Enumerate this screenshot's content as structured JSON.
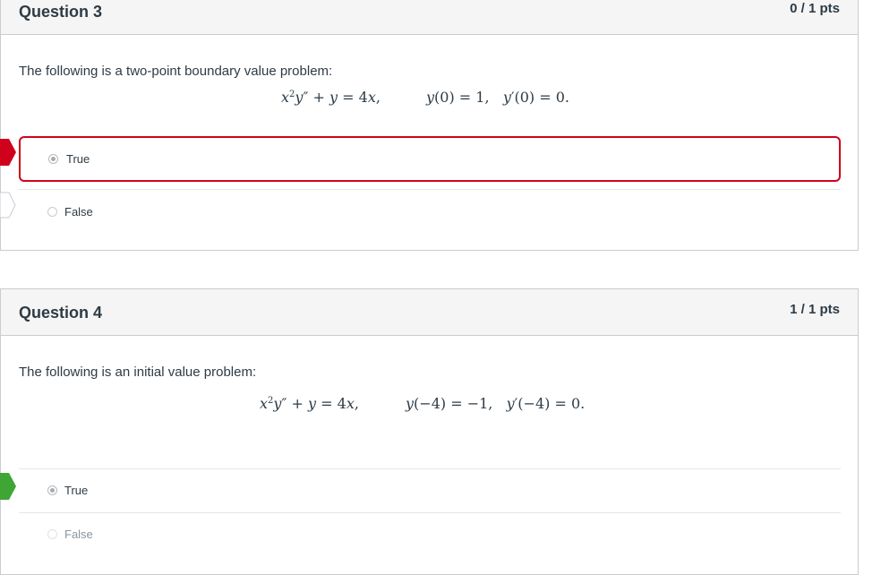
{
  "questions": [
    {
      "title": "Question 3",
      "points": "0 / 1 pts",
      "prompt": "The following is a two-point boundary value problem:",
      "answers": [
        {
          "label": "True",
          "selected": true,
          "marker": "incorrect"
        },
        {
          "label": "False",
          "selected": false,
          "marker": "correct-answer-outline"
        }
      ]
    },
    {
      "title": "Question 4",
      "points": "1 / 1 pts",
      "prompt": "The following is an initial value problem:",
      "answers": [
        {
          "label": "True",
          "selected": true,
          "marker": "correct"
        },
        {
          "label": "False",
          "selected": false,
          "marker": "none"
        }
      ]
    }
  ],
  "colors": {
    "incorrect": "#d0021b",
    "correct": "#3fa535",
    "border": "#c7cdd1",
    "header_bg": "#f5f5f5",
    "text": "#2d3b45"
  }
}
